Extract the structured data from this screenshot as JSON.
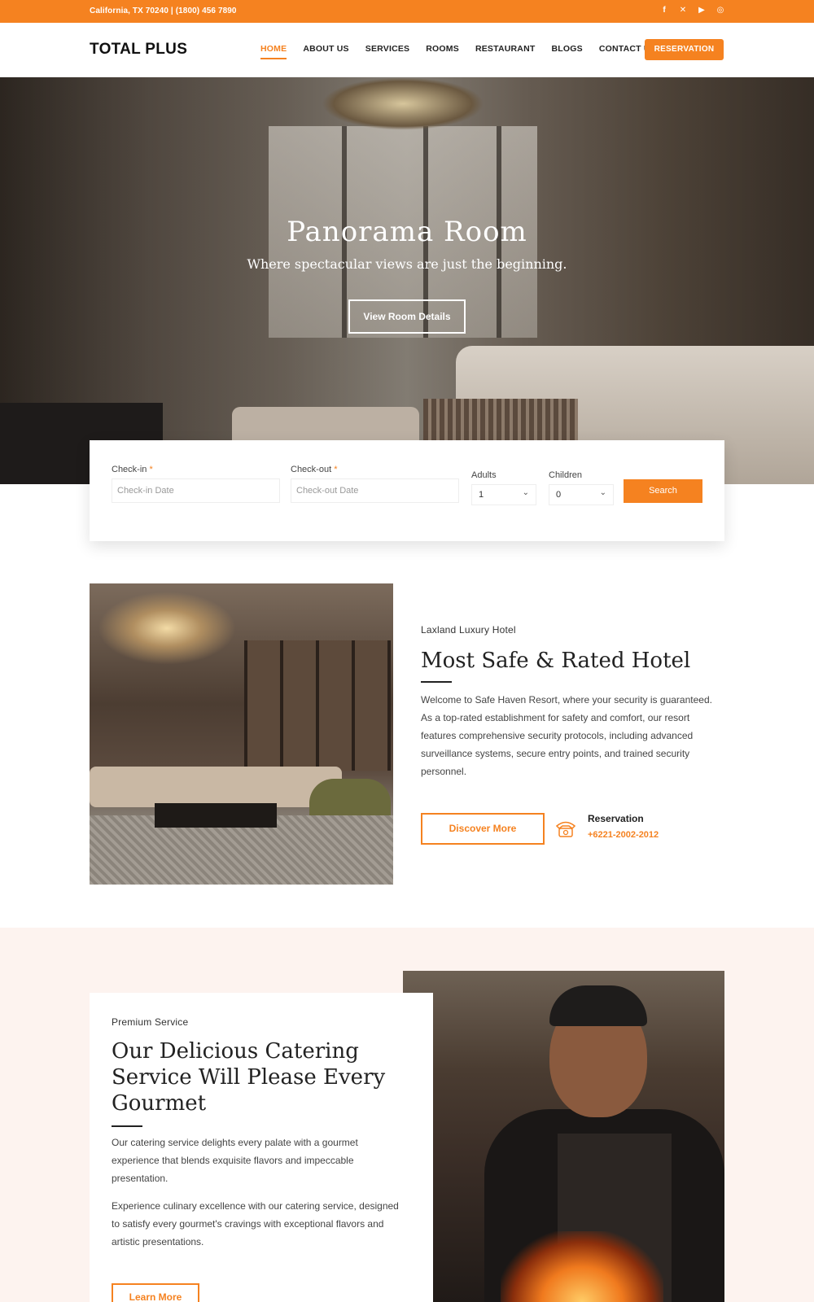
{
  "topbar": {
    "address": "California, TX 70240 | (1800) 456 7890",
    "social_icons": [
      "facebook-icon",
      "x-icon",
      "youtube-icon",
      "instagram-icon"
    ]
  },
  "brand": {
    "logo": "TOTAL PLUS",
    "accent": "#f58220"
  },
  "nav": {
    "items": [
      "HOME",
      "ABOUT US",
      "SERVICES",
      "ROOMS",
      "RESTAURANT",
      "BLOGS",
      "CONTACT US"
    ],
    "active": "HOME",
    "cta": "RESERVATION"
  },
  "hero": {
    "title": "Panorama Room",
    "subtitle": "Where spectacular views are just the beginning.",
    "button": "View Room Details"
  },
  "booking": {
    "checkin_label": "Check-in",
    "checkin_placeholder": "Check-in Date",
    "checkout_label": "Check-out",
    "checkout_placeholder": "Check-out Date",
    "required_mark": "*",
    "adults_label": "Adults",
    "adults_value": "1",
    "children_label": "Children",
    "children_value": "0",
    "search_button": "Search"
  },
  "about": {
    "kicker": "Laxland Luxury Hotel",
    "heading": "Most Safe & Rated Hotel",
    "body": "Welcome to Safe Haven Resort, where your security is guaranteed. As a top-rated establishment for safety and comfort, our resort features comprehensive security protocols, including advanced surveillance systems, secure entry points, and trained security personnel.",
    "button": "Discover More",
    "reservation_label": "Reservation",
    "reservation_phone": "+6221-2002-2012"
  },
  "catering": {
    "kicker": "Premium Service",
    "heading_line1": "Our Delicious Catering",
    "heading_line2": "Service Will Please Every",
    "heading_line3": "Gourmet",
    "para1": "Our catering service delights every palate with a gourmet experience that blends exquisite flavors and impeccable presentation.",
    "para2": "Experience culinary excellence with our catering service, designed to satisfy every gourmet's cravings with exceptional flavors and artistic presentations.",
    "button": "Learn More"
  }
}
